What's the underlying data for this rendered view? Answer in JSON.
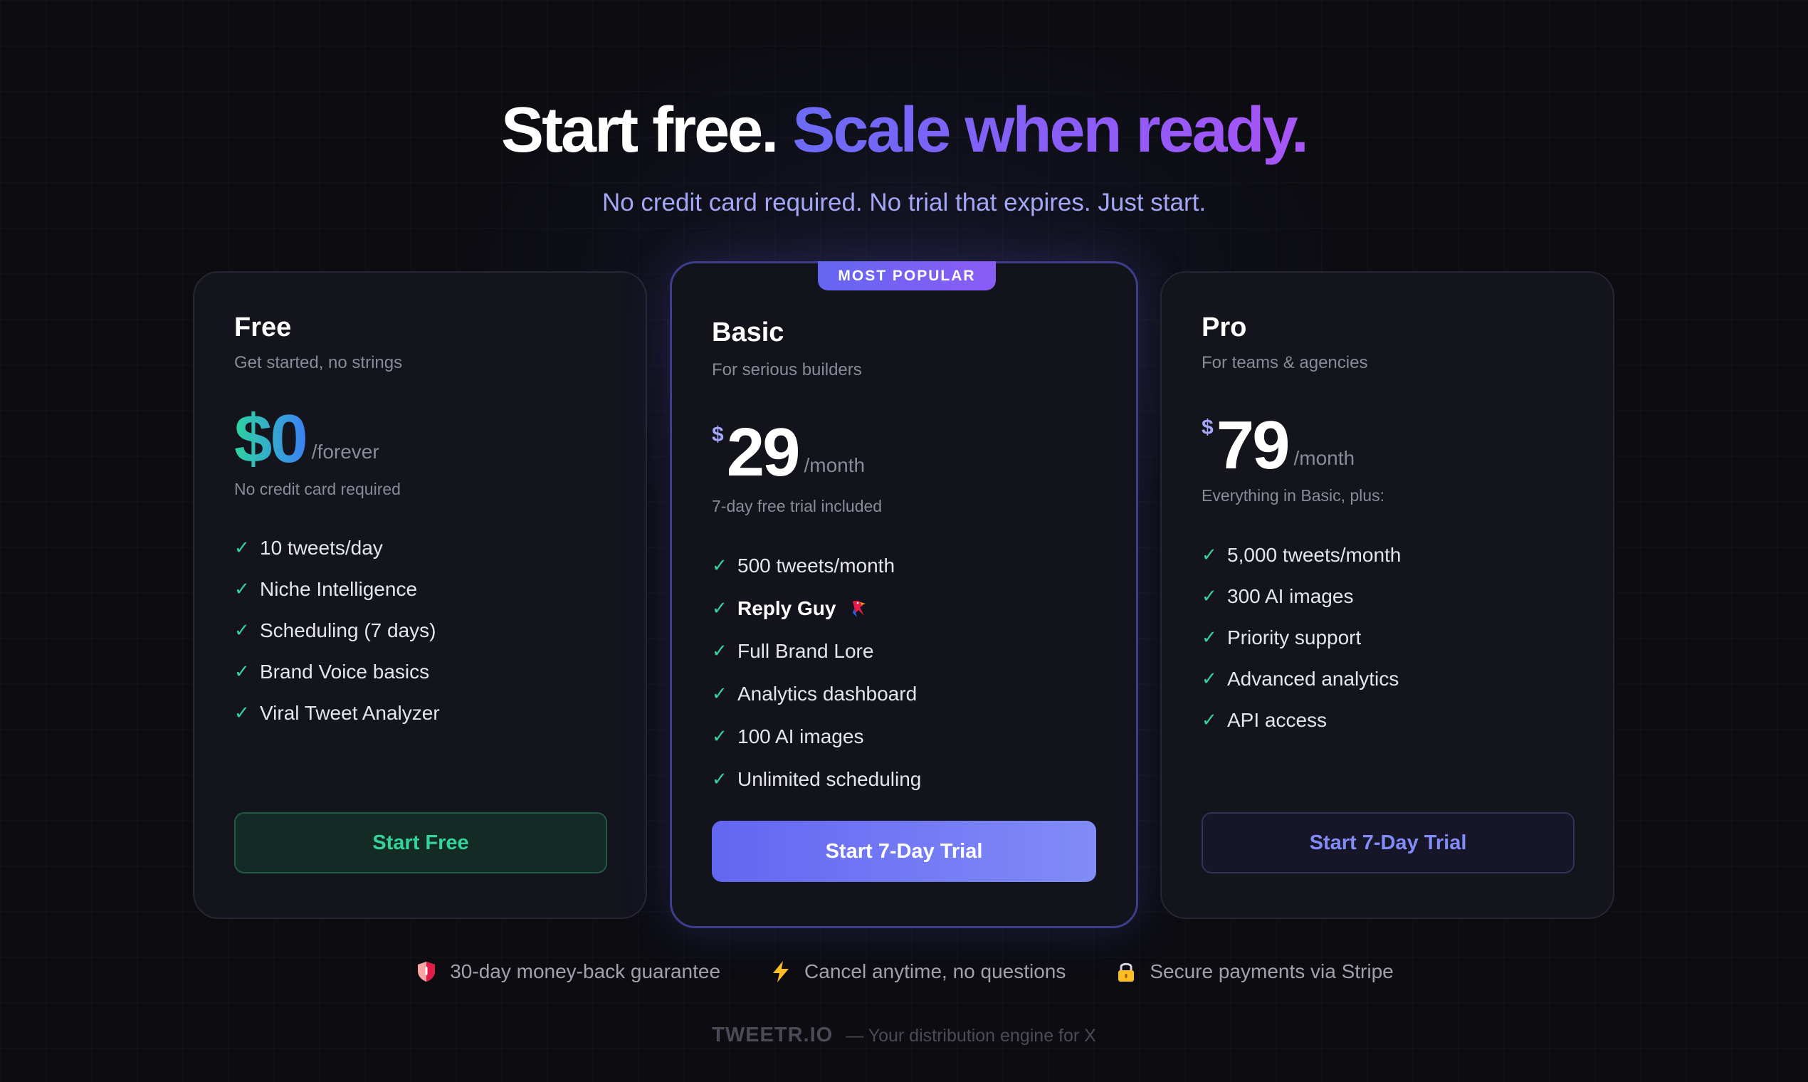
{
  "hero": {
    "title_white": "Start free.",
    "title_accent": "Scale when ready.",
    "subtitle": "No credit card required. No trial that expires. Just start."
  },
  "plans": [
    {
      "name": "Free",
      "tagline": "Get started, no strings",
      "currency": "",
      "price": "$0",
      "period": "/forever",
      "note": "No credit card required",
      "features": [
        "10 tweets/day",
        "Niche Intelligence",
        "Scheduling (7 days)",
        "Brand Voice basics",
        "Viral Tweet Analyzer"
      ],
      "cta": "Start Free",
      "accent": "#34d399"
    },
    {
      "name": "Basic",
      "badge": "MOST POPULAR",
      "tagline": "For serious builders",
      "currency": "$",
      "price": "29",
      "period": "/month",
      "note": "7-day free trial included",
      "features": [
        "500 tweets/month",
        "Reply Guy",
        "Full Brand Lore",
        "Analytics dashboard",
        "100 AI images",
        "Unlimited scheduling"
      ],
      "feature_icon": "parrot-icon",
      "cta": "Start 7-Day Trial",
      "accent": "#6366f1"
    },
    {
      "name": "Pro",
      "tagline": "For teams & agencies",
      "currency": "$",
      "price": "79",
      "period": "/month",
      "note": "Everything in Basic, plus:",
      "features": [
        "5,000 tweets/month",
        "300 AI images",
        "Priority support",
        "Advanced analytics",
        "API access"
      ],
      "cta": "Start 7-Day Trial",
      "accent": "#818cf8"
    }
  ],
  "guarantees": [
    {
      "icon": "shield-icon",
      "text": "30-day money-back guarantee"
    },
    {
      "icon": "lightning-icon",
      "text": "Cancel anytime, no questions"
    },
    {
      "icon": "lock-icon",
      "text": "Secure payments via Stripe"
    }
  ],
  "footer": {
    "brand": "TWEETR.IO",
    "tagline": "— Your distribution engine for X"
  },
  "colors": {
    "background": "#0c0c11",
    "card": "#14141d",
    "check": "#34d399",
    "accent_indigo": "#6366f1",
    "accent_violet": "#a855f7",
    "free_price_gradient": [
      "#2dd4a0",
      "#3b82f6"
    ]
  }
}
